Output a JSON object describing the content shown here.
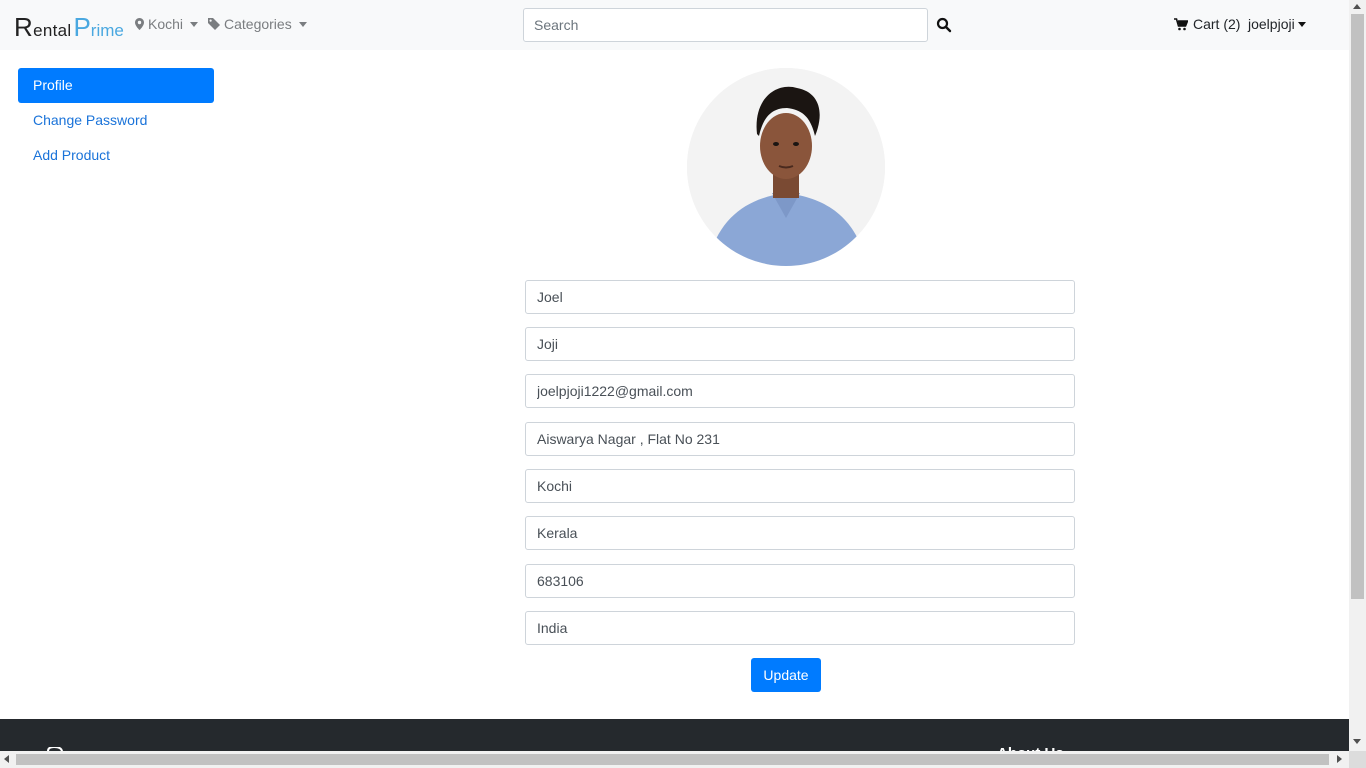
{
  "header": {
    "brand_part1": "Rental",
    "brand_part2": "Prime",
    "location_label": "Kochi",
    "categories_label": "Categories",
    "search_placeholder": "Search",
    "cart_label": "Cart (2)",
    "user_label": "joelpjoji"
  },
  "sidebar": {
    "items": [
      {
        "label": "Profile",
        "active": true
      },
      {
        "label": "Change Password",
        "active": false
      },
      {
        "label": "Add Product",
        "active": false
      }
    ]
  },
  "profile_form": {
    "first_name": "Joel",
    "last_name": "Joji",
    "email": "joelpjoji1222@gmail.com",
    "address": "Aiswarya Nagar , Flat No 231",
    "city": "Kochi",
    "state": "Kerala",
    "pincode": "683106",
    "country": "India",
    "submit_label": "Update"
  },
  "footer": {
    "heading": "About Us"
  },
  "colors": {
    "primary": "#007bff",
    "navbar_bg": "#f8f9fa",
    "footer_bg": "#25292d",
    "brand_accent": "#4aa8e0"
  }
}
